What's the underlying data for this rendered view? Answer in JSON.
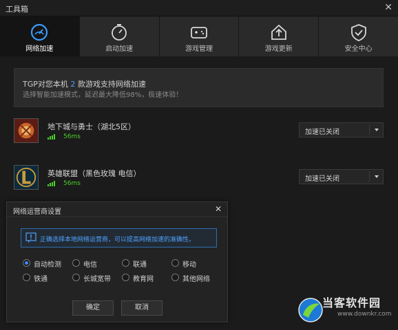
{
  "window": {
    "title": "工具箱"
  },
  "tabs": [
    {
      "label": "网络加速",
      "icon": "speedometer-icon"
    },
    {
      "label": "启动加速",
      "icon": "stopwatch-icon"
    },
    {
      "label": "游戏管理",
      "icon": "gamepad-icon"
    },
    {
      "label": "游戏更新",
      "icon": "upload-icon"
    },
    {
      "label": "安全中心",
      "icon": "shield-check-icon"
    }
  ],
  "notice": {
    "line1_prefix": "TGP对您本机",
    "count": "2",
    "line1_suffix": "款游戏支持网络加速",
    "line2": "选择智能加速模式，延迟最大降低98%，极速体验！"
  },
  "games": [
    {
      "name": "地下城与勇士（湖北5区）",
      "ping": "56ms",
      "status": "加速已关闭",
      "icon": "dnf-game-icon"
    },
    {
      "name": "英雄联盟（黑色玫瑰 电信）",
      "ping": "56ms",
      "status": "加速已关闭",
      "icon": "lol-game-icon"
    }
  ],
  "dialog": {
    "title": "网络运营商设置",
    "tip": "正确选择本地网络运营商，可以提高网络加速的准确性。",
    "options": [
      "自动检测",
      "电信",
      "联通",
      "移动",
      "铁通",
      "长城宽带",
      "教育网",
      "其他网络"
    ],
    "selected": "自动检测",
    "confirm": "确定",
    "cancel": "取消"
  },
  "watermark": {
    "name": "当客软件园",
    "url": "www.downkr.com"
  },
  "colors": {
    "accent_blue": "#3c8cff",
    "ping_green": "#4bd12a",
    "active_tab": "#141414"
  }
}
